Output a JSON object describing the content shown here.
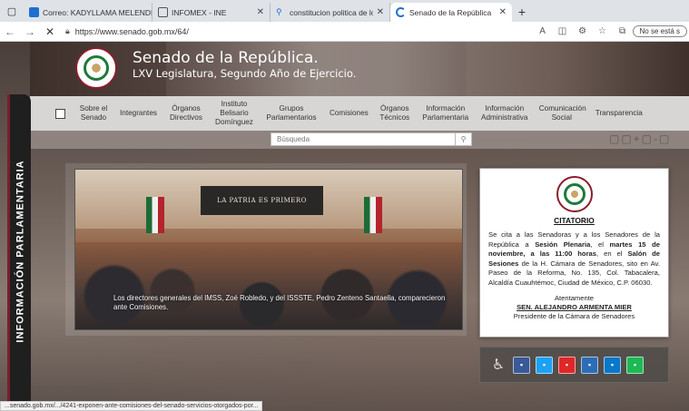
{
  "browser": {
    "tabs": [
      {
        "label": "Correo: KADYLLAMA MELENDEZ",
        "icon": "outlook-icon",
        "active": false
      },
      {
        "label": "INFOMEX - INE",
        "icon": "page-icon",
        "active": false
      },
      {
        "label": "constitucion politica de los estado",
        "icon": "search-icon",
        "active": false
      },
      {
        "label": "Senado de la República",
        "icon": "loading-icon",
        "active": true
      }
    ],
    "url": "https://www.senado.gob.mx/64/",
    "sync_label": "No se está s",
    "status_url": "...senado.gob.mx/.../4241-exponen-ante-comisiones-del-senado-servicios-otorgados-por..."
  },
  "site": {
    "title": "Senado de la República.",
    "subtitle": "LXV Legislatura, Segundo Año de Ejercicio.",
    "side_tab": "INFORMACIÓN PARLAMENTARIA",
    "nav": [
      "Sobre el Senado",
      "Integrantes",
      "Órganos Directivos",
      "Instituto Belisario Domínguez",
      "Grupos Parlamentarios",
      "Comisiones",
      "Órganos Técnicos",
      "Información Parlamentaria",
      "Información Administrativa",
      "Comunicación Social",
      "Transparencia"
    ],
    "search_placeholder": "Búsqueda"
  },
  "carousel": {
    "podium_text": "LA PATRIA ES PRIMERO",
    "caption": "Los directores generales del IMSS, Zoé Robledo, y del ISSSTE, Pedro Zenteno Santaella, comparecieron ante Comisiones."
  },
  "notice": {
    "title": "CITATORIO",
    "body_1": "Se cita a las Senadoras y a los Senadores de la República a ",
    "body_bold_1": "Sesión Plenaria",
    "body_2": ", el ",
    "body_bold_2": "martes 15 de noviembre, a las 11:00 horas",
    "body_3": ", en el ",
    "body_bold_3": "Salón de Sesiones",
    "body_4": " de la H. Cámara de Senadores, sito en Av. Paseo de la Reforma, No. 135, Col. Tabacalera, Alcaldía Cuauhtémoc, Ciudad de México, C.P. 06030.",
    "closing": "Atentamente",
    "signer": "SEN. ALEJANDRO ARMENTA MIER",
    "signer_role": "Presidente de la Cámara de Senadores"
  },
  "share_buttons": [
    {
      "name": "facebook",
      "color": "#3b5998"
    },
    {
      "name": "twitter",
      "color": "#1da1f2"
    },
    {
      "name": "youtube",
      "color": "#e02626"
    },
    {
      "name": "instagram",
      "color": "#2d6db5"
    },
    {
      "name": "linkedin",
      "color": "#0a78c8"
    },
    {
      "name": "spotify",
      "color": "#1db954"
    }
  ],
  "colors": {
    "accent_red": "#8b1d2c",
    "accent_green": "#1e7a3a"
  }
}
